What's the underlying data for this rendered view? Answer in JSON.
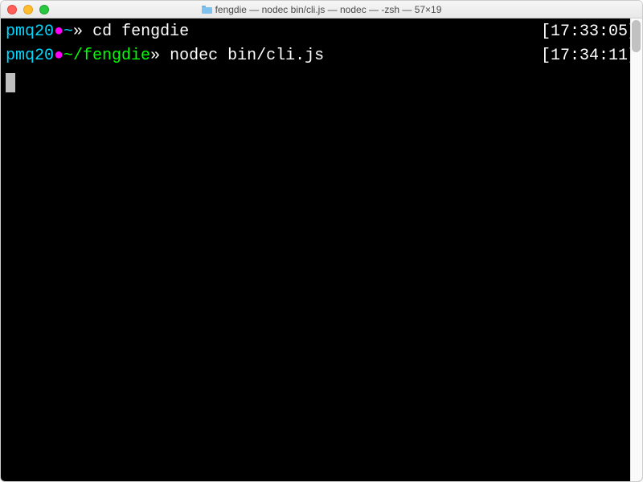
{
  "window": {
    "title": "fengdie — nodec bin/cli.js — nodec — -zsh — 57×19"
  },
  "lines": [
    {
      "user": "pmq20",
      "dot": "●",
      "path": "~",
      "arrow": "»",
      "command": "cd fengdie",
      "timestamp": "[17:33:05]"
    },
    {
      "user": "pmq20",
      "dot": "●",
      "path": "~/fengdie",
      "arrow": "»",
      "command": "nodec bin/cli.js",
      "timestamp": "[17:34:11]"
    }
  ]
}
